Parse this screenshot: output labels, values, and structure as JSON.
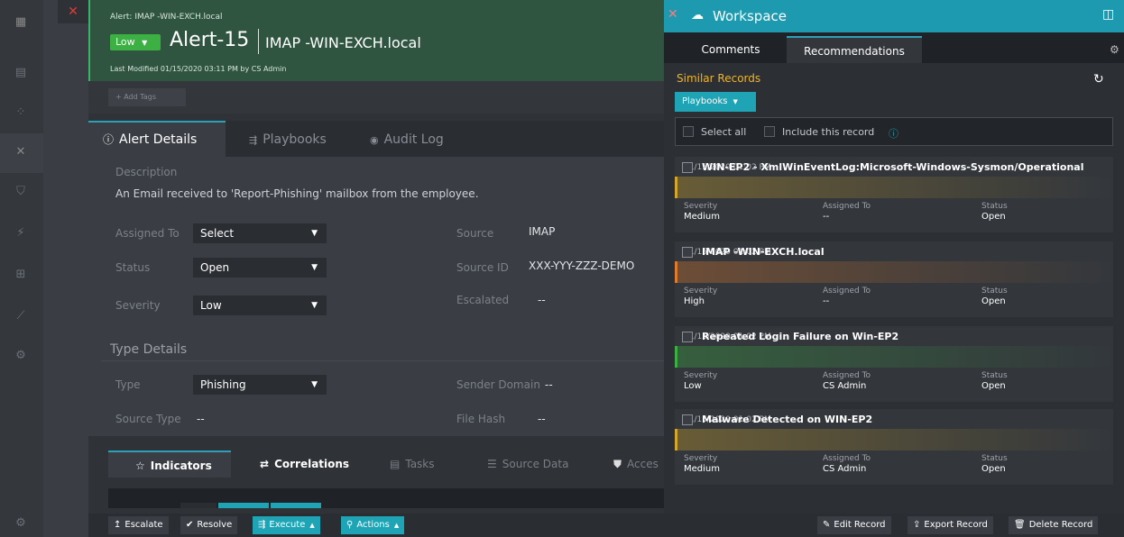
{
  "alert": {
    "header_small": "Alert: IMAP -WIN-EXCH.local",
    "severity_badge": "Low",
    "title": "Alert-15",
    "subtitle": "IMAP -WIN-EXCH.local",
    "modified": "Last Modified 01/15/2020 03:11 PM by CS Admin",
    "add_tags": "+ Add Tags"
  },
  "tabs": [
    {
      "label": "Alert Details",
      "icon": "alert-icon"
    },
    {
      "label": "Playbooks",
      "icon": "playbooks-icon"
    },
    {
      "label": "Audit Log",
      "icon": "eye-icon"
    }
  ],
  "details": {
    "description_label": "Description",
    "description": "An Email received to 'Report-Phishing' mailbox from the employee.",
    "assigned_to_label": "Assigned To",
    "assigned_to": "Select",
    "status_label": "Status",
    "status": "Open",
    "severity_label": "Severity",
    "severity": "Low",
    "source_label": "Source",
    "source": "IMAP",
    "source_id_label": "Source ID",
    "source_id": "XXX-YYY-ZZZ-DEMO",
    "escalated_label": "Escalated",
    "escalated": "--",
    "type_details": "Type Details",
    "type_label": "Type",
    "type": "Phishing",
    "sender_domain_label": "Sender Domain",
    "sender_domain": "--",
    "source_type_label": "Source Type",
    "source_type": "--",
    "file_hash_label": "File Hash",
    "file_hash": "--"
  },
  "lower_tabs": [
    {
      "label": "Indicators",
      "icon": "star-icon"
    },
    {
      "label": "Correlations",
      "icon": "arrows-icon"
    },
    {
      "label": "Tasks",
      "icon": "tasks-icon"
    },
    {
      "label": "Source Data",
      "icon": "database-icon"
    },
    {
      "label": "Acces",
      "icon": "shield-icon"
    }
  ],
  "bottom_actions": {
    "escalate": "Escalate",
    "resolve": "Resolve",
    "execute": "Execute",
    "actions": "Actions",
    "edit": "Edit Record",
    "export": "Export Record",
    "delete": "Delete Record"
  },
  "workspace": {
    "title": "Workspace",
    "tabs": [
      "Comments",
      "Recommendations"
    ],
    "similar_records": "Similar Records",
    "playbooks_dropdown": "Playbooks",
    "select_all": "Select all",
    "include_record": "Include this record",
    "meta_labels": {
      "severity": "Severity",
      "assigned": "Assigned To",
      "status": "Status"
    },
    "records": [
      {
        "date": "01/15/2020 01:02 PM",
        "title": "WIN-EP2 - XmlWinEventLog:Microsoft-Windows-Sysmon/Operational",
        "severity": "Medium",
        "assigned": "--",
        "status": "Open",
        "color": "#d4a72c"
      },
      {
        "date": "01/15/2020 01:02 PM",
        "title": "IMAP -WIN-EXCH.local",
        "severity": "High",
        "assigned": "--",
        "status": "Open",
        "color": "#e07a2c"
      },
      {
        "date": "01/15/2020 01:02 PM",
        "title": "Repeated Login Failure on Win-EP2",
        "severity": "Low",
        "assigned": "CS Admin",
        "status": "Open",
        "color": "#3cb043"
      },
      {
        "date": "01/15/2020 01:02 PM",
        "title": "Malware Detected on WIN-EP2",
        "severity": "Medium",
        "assigned": "CS Admin",
        "status": "Open",
        "color": "#d4a72c"
      }
    ]
  },
  "colors": {
    "accent": "#1fa4b5",
    "low": "#3cb043",
    "header_bg": "#2f5540"
  }
}
